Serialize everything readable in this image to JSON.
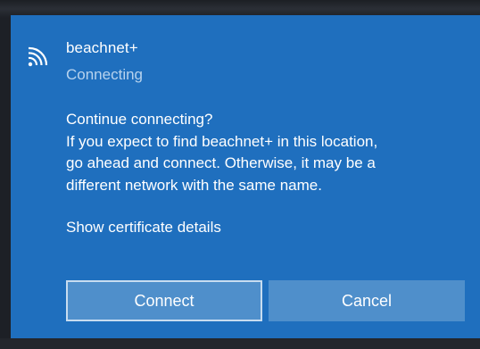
{
  "network": {
    "name": "beachnet+",
    "status": "Connecting",
    "icon": "wifi-signal-icon"
  },
  "prompt": {
    "lines": [
      "Continue connecting?",
      "If you expect to find beachnet+ in this location,",
      "go ahead and connect. Otherwise, it may be a",
      "different network with the same name."
    ],
    "certificate_link": "Show certificate details"
  },
  "buttons": {
    "connect_label": "Connect",
    "cancel_label": "Cancel"
  },
  "colors": {
    "panel_bg": "#1f6fbe",
    "button_bg": "#4f8fcb",
    "status_text": "#b7d3ee",
    "focus_border": "#c7dcf0"
  }
}
